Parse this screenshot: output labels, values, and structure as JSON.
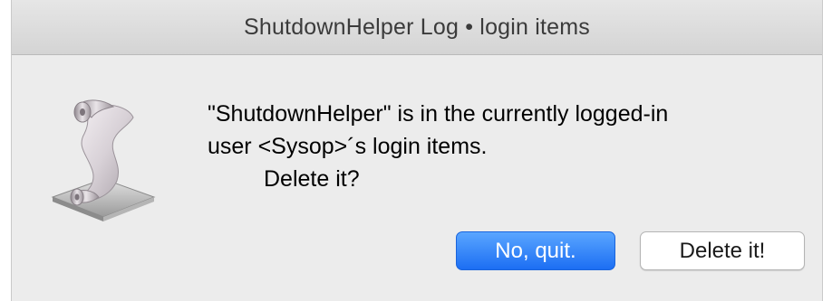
{
  "window": {
    "title": "ShutdownHelper Log • login items"
  },
  "dialog": {
    "icon": "script-editor-scroll-icon",
    "message_lines": [
      "\"ShutdownHelper\" is in the currently logged-in",
      "user <Sysop>´s login items.",
      "Delete it?"
    ]
  },
  "buttons": {
    "default_label": "No, quit.",
    "secondary_label": "Delete it!"
  },
  "colors": {
    "default_button": "#1c6ef3",
    "window_background": "#ececec"
  }
}
